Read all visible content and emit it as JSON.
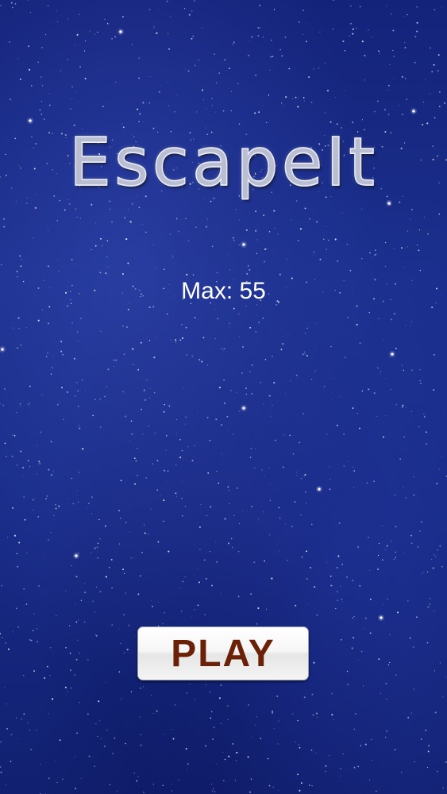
{
  "app": {
    "title": "EscapeIt"
  },
  "stats": {
    "max_label": "Max: 55"
  },
  "controls": {
    "play_label": "PLAY"
  },
  "colors": {
    "background": "#1a2f8c",
    "title_fill": "#b9bed2",
    "max_text": "#ffffff",
    "play_text": "#6b2108",
    "button_face": "#f4f4f4"
  }
}
